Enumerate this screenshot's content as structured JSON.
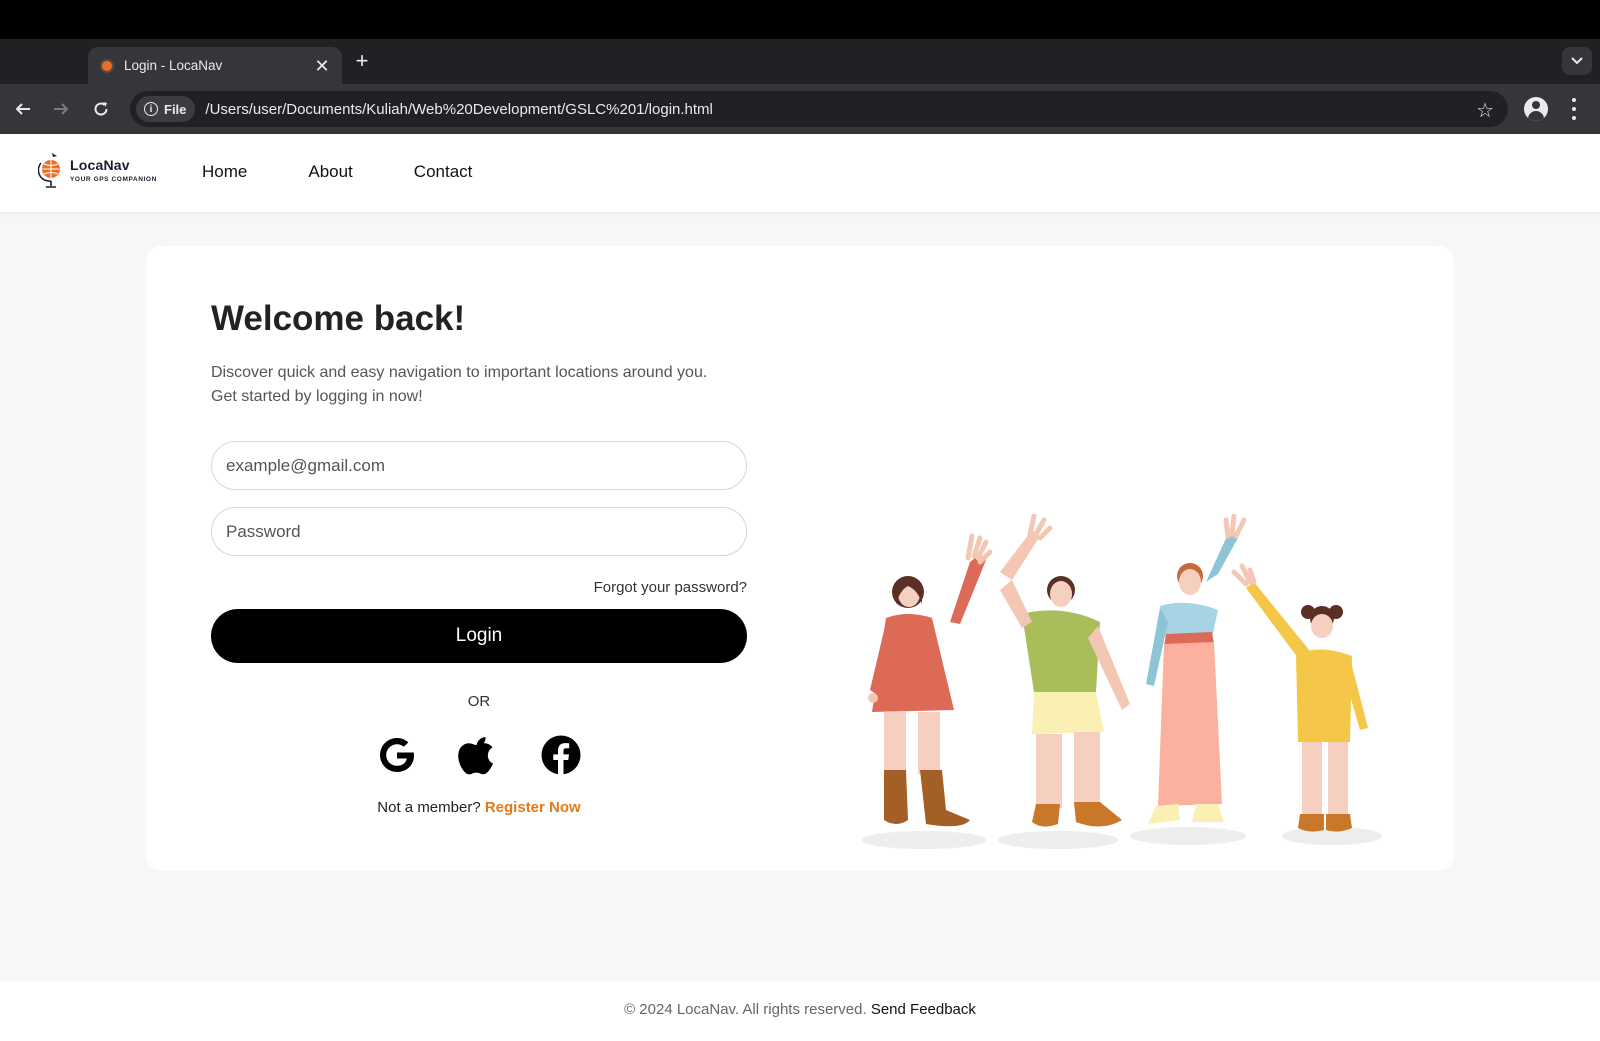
{
  "browser": {
    "tab_title": "Login - LocaNav",
    "new_tab": "+",
    "close": "✕",
    "file_chip": "File",
    "url": "/Users/user/Documents/Kuliah/Web%20Development/GSLC%201/login.html"
  },
  "site": {
    "logo_name": "LocaNav",
    "logo_tagline": "YOUR GPS COMPANION",
    "nav": [
      "Home",
      "About",
      "Contact"
    ]
  },
  "login": {
    "title": "Welcome back!",
    "desc_line1": "Discover quick and easy navigation to important locations around you.",
    "desc_line2": "Get started by logging in now!",
    "email_placeholder": "example@gmail.com",
    "password_placeholder": "Password",
    "forgot": "Forgot your password?",
    "button": "Login",
    "or": "OR",
    "socials": [
      "google-icon",
      "apple-icon",
      "facebook-icon"
    ],
    "register_prefix": "Not a member?",
    "register_link": "Register Now"
  },
  "footer": {
    "copyright": "© 2024 LocaNav. All rights reserved.",
    "feedback": "Send Feedback"
  },
  "colors": {
    "accent": "#e07a1a",
    "button": "#000000",
    "background": "#f7f7f7"
  }
}
